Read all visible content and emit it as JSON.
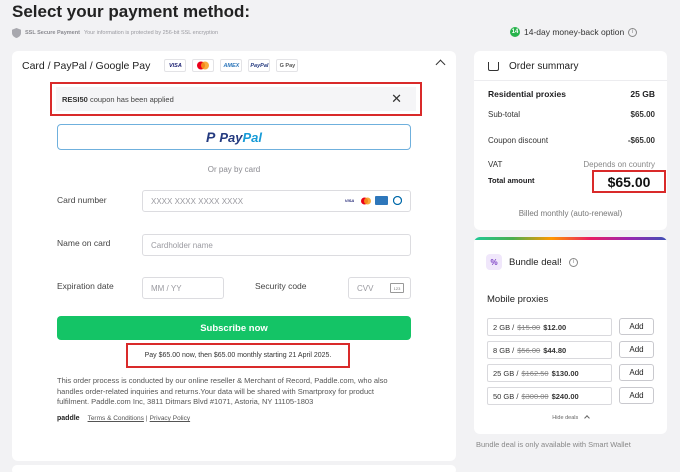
{
  "page": {
    "title": "Select your payment method:"
  },
  "security": {
    "title": "SSL Secure Payment",
    "text": "Your information is protected by 256-bit SSL encryption"
  },
  "moneyback": {
    "badge": "14",
    "label": "14-day money-back option"
  },
  "payment": {
    "methods_title": "Card / PayPal / Google Pay",
    "logos": [
      "VISA",
      "MC",
      "AMEX",
      "PayPal",
      "G Pay"
    ],
    "coupon_code": "RESI50",
    "coupon_text": " coupon has been applied",
    "paypal_pay": "Pay",
    "paypal_pal": "Pal",
    "divider": "Or pay by card",
    "card_number_label": "Card number",
    "card_number_placeholder": "XXXX XXXX XXXX XXXX",
    "name_label": "Name on card",
    "name_placeholder": "Cardholder name",
    "expiry_label": "Expiration date",
    "expiry_placeholder": "MM / YY",
    "security_code_label": "Security code",
    "cvv_placeholder": "CVV",
    "subscribe_label": "Subscribe now",
    "pay_note": "Pay $65.00 now, then $65.00 monthly starting 21 April 2025.",
    "legal": "This order process is conducted by our online reseller & Merchant of Record, Paddle.com, who also handles order-related inquiries and returns.Your data will be shared with Smartproxy for product fulfilment. Paddle.com Inc, 3811 Ditmars Blvd #1071, Astoria, NY 11105-1803",
    "paddle": "paddle",
    "terms": "Terms & Conditions",
    "privacy": "Privacy Policy",
    "separator": "|"
  },
  "summary": {
    "title": "Order summary",
    "product": "Residential proxies",
    "product_qty": "25 GB",
    "subtotal_label": "Sub-total",
    "subtotal": "$65.00",
    "discount_label": "Coupon discount",
    "discount": "-$65.00",
    "vat_label": "VAT",
    "vat": "Depends on country",
    "total_label": "Total amount",
    "total": "$65.00",
    "billed": "Billed monthly (auto-renewal)"
  },
  "bundle": {
    "title": "Bundle deal!",
    "icon": "%",
    "subtitle": "Mobile proxies",
    "deals": [
      {
        "size": "2 GB /",
        "old": "$15.00",
        "new": "$12.00",
        "add": "Add"
      },
      {
        "size": "8 GB /",
        "old": "$56.00",
        "new": "$44.80",
        "add": "Add"
      },
      {
        "size": "25 GB /",
        "old": "$162.50",
        "new": "$130.00",
        "add": "Add"
      },
      {
        "size": "50 GB /",
        "old": "$300.00",
        "new": "$240.00",
        "add": "Add"
      }
    ],
    "hide_deals": "Hide deals",
    "note": "Bundle deal is only available with Smart Wallet"
  },
  "colors": {
    "accent_green": "#14c466",
    "highlight_red": "#d92a2a",
    "paypal_dark": "#253b80",
    "paypal_light": "#179bd7"
  }
}
